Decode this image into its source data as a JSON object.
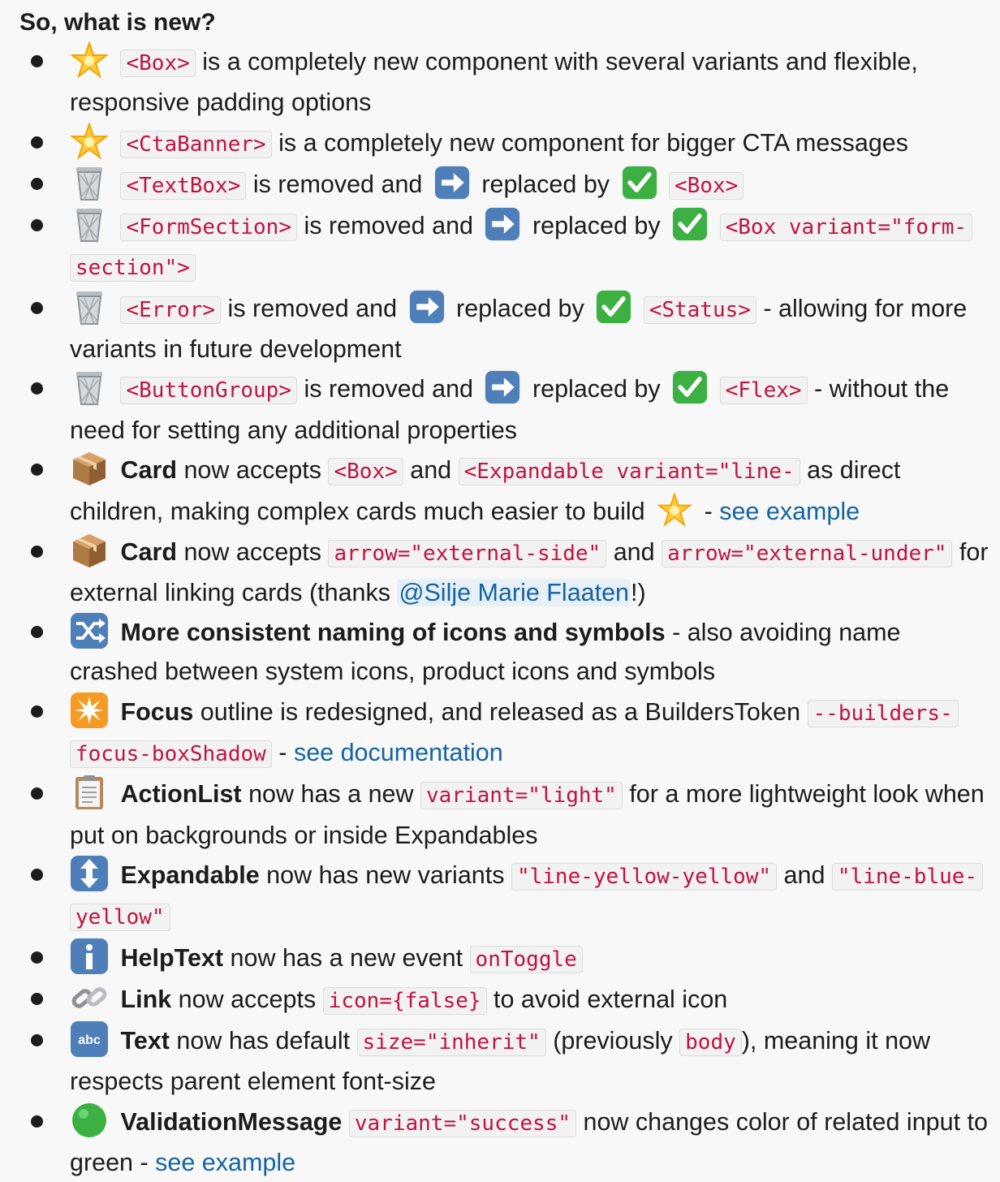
{
  "heading": "So, what is new?",
  "items": [
    {
      "emoji": "glowing-star-icon",
      "code1": "<Box>",
      "text1": " is a completely new component with several variants and flexible, responsive padding options"
    },
    {
      "emoji": "glowing-star-icon",
      "code1": "<CtaBanner>",
      "text1": " is a completely new component for bigger CTA messages"
    },
    {
      "emoji": "wastebasket-icon",
      "code1": "<TextBox>",
      "text1": " is removed and ",
      "text2": " replaced by ",
      "code2": "<Box>"
    },
    {
      "emoji": "wastebasket-icon",
      "code1": "<FormSection>",
      "text1": " is removed and ",
      "text2": " replaced by ",
      "code2": "<Box variant=\"form-section\">"
    },
    {
      "emoji": "wastebasket-icon",
      "code1": "<Error>",
      "text1": " is removed and ",
      "text2": " replaced by ",
      "code2": "<Status>",
      "text3": " - allowing for more variants in future development"
    },
    {
      "emoji": "wastebasket-icon",
      "code1": "<ButtonGroup>",
      "text1": " is removed and ",
      "text2": " replaced by ",
      "code2": "<Flex>",
      "text3": " - without the need for setting any additional properties"
    },
    {
      "emoji": "package-icon",
      "bold": "Card",
      "text1": " now accepts ",
      "code1": "<Box>",
      "text2": " and ",
      "code2": "<Expandable variant=\"line-",
      "text3": " as direct children, making complex cards much easier to build ",
      "text4": " - ",
      "link": "see example"
    },
    {
      "emoji": "package-icon",
      "bold": "Card",
      "text1": " now accepts ",
      "code1": "arrow=\"external-side\"",
      "text2": " and ",
      "code2": "arrow=\"external-under\"",
      "text3": " for external linking cards (thanks ",
      "mention": "@Silje Marie Flaaten",
      "text4": "!)"
    },
    {
      "emoji": "shuffle-icon",
      "bold": "More consistent naming of icons and symbols",
      "text1": " - also avoiding name crashed between system icons, product icons and symbols"
    },
    {
      "emoji": "eight-pointed-star-icon",
      "bold": "Focus",
      "text1": " outline is redesigned, and released as a BuildersToken ",
      "code1": "--builders-focus-boxShadow",
      "text2": " - ",
      "link": "see documentation"
    },
    {
      "emoji": "clipboard-icon",
      "bold": "ActionList",
      "text1": " now has a new ",
      "code1": "variant=\"light\"",
      "text2": " for a more lightweight look when put on backgrounds or inside Expandables"
    },
    {
      "emoji": "up-down-arrow-icon",
      "bold": "Expandable",
      "text1": " now has new variants ",
      "code1": "\"line-yellow-yellow\"",
      "text2": " and ",
      "code2": "\"line-blue-yellow\""
    },
    {
      "emoji": "information-icon",
      "bold": "HelpText",
      "text1": " now has a new event ",
      "code1": "onToggle"
    },
    {
      "emoji": "link-icon",
      "bold": "Link",
      "text1": " now accepts ",
      "code1": "icon={false}",
      "text2": " to avoid external icon"
    },
    {
      "emoji": "abc-icon",
      "bold": "Text",
      "text1": " now has default ",
      "code1": "size=\"inherit\"",
      "text2": " (previously ",
      "code2": "body",
      "text3": "), meaning it now respects parent element font-size"
    },
    {
      "emoji": "green-circle-icon",
      "bold": "ValidationMessage",
      "text1": " ",
      "code1": "variant=\"success\"",
      "text2": " now changes color of related input to green - ",
      "link": "see example"
    }
  ],
  "colors": {
    "code_text": "#c01343",
    "link": "#1264a3",
    "text": "#1d1c1d",
    "background": "#f8f8f8"
  }
}
